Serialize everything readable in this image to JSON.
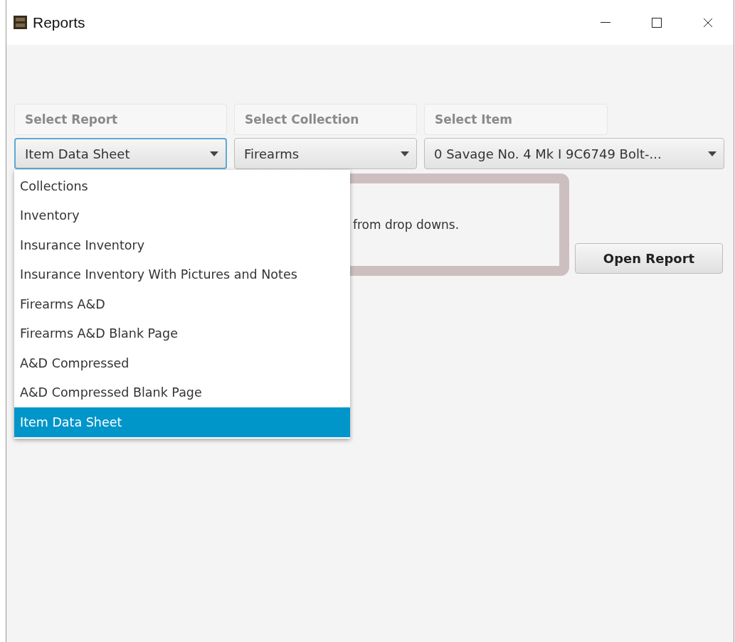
{
  "window": {
    "title": "Reports"
  },
  "selectors": [
    {
      "label": "Select Report",
      "value": "Item Data Sheet",
      "focused": true
    },
    {
      "label": "Select Collection",
      "value": "Firearms",
      "focused": false
    },
    {
      "label": "Select Item",
      "value": "0 Savage  No. 4 Mk I 9C6749 Bolt-...",
      "focused": false
    }
  ],
  "dropdown": {
    "items": [
      {
        "label": "Collections",
        "selected": false
      },
      {
        "label": "Inventory",
        "selected": false
      },
      {
        "label": "Insurance Inventory",
        "selected": false
      },
      {
        "label": "Insurance Inventory With Pictures and Notes",
        "selected": false
      },
      {
        "label": "Firearms A&D",
        "selected": false
      },
      {
        "label": "Firearms A&D Blank Page",
        "selected": false
      },
      {
        "label": "A&D Compressed",
        "selected": false
      },
      {
        "label": "A&D Compressed Blank Page",
        "selected": false
      },
      {
        "label": "Item Data Sheet",
        "selected": true
      }
    ]
  },
  "message": "from drop downs.",
  "buttons": [
    {
      "label": "Open Report"
    }
  ]
}
